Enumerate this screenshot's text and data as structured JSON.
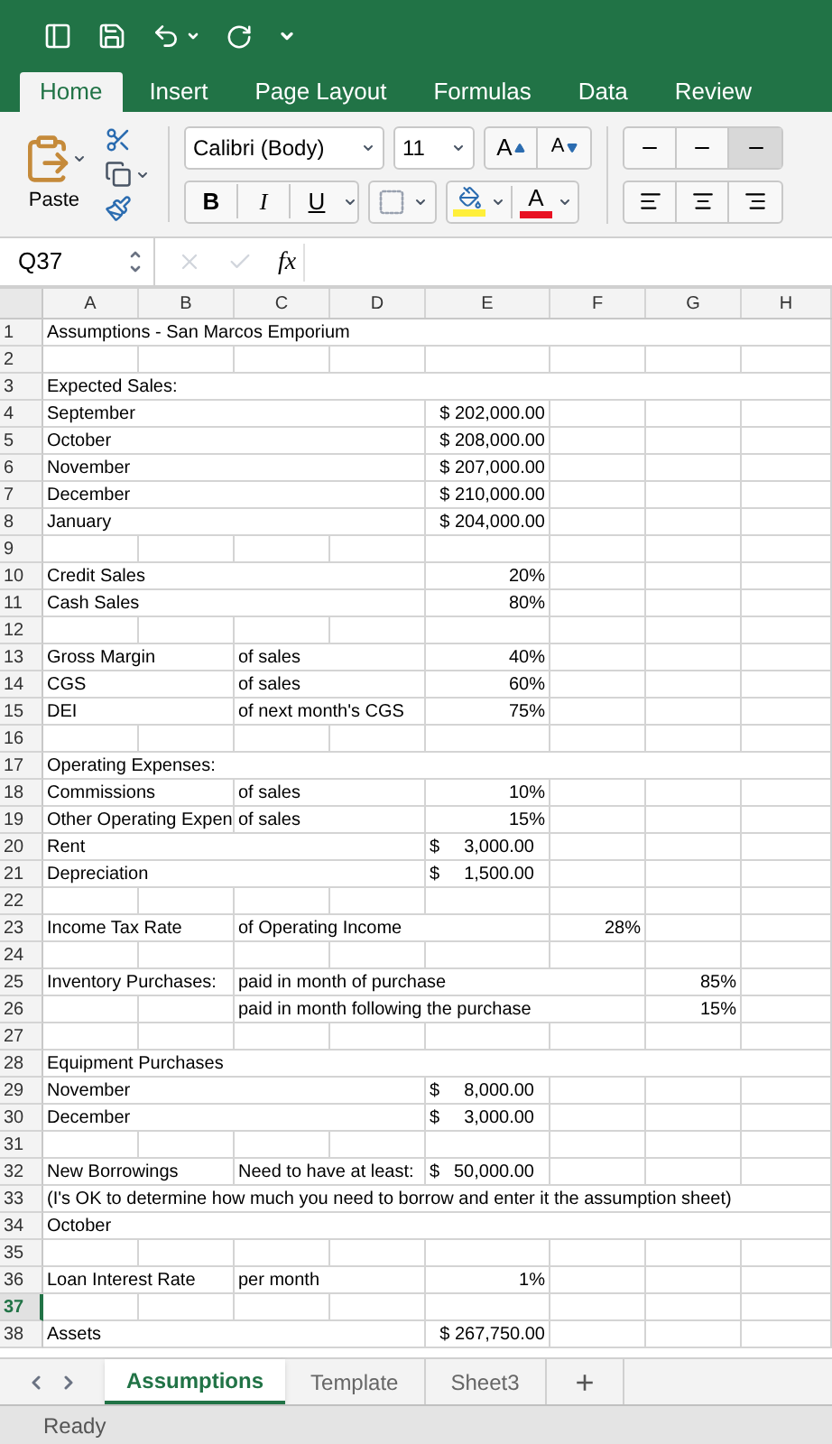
{
  "ribbon_tabs": [
    {
      "label": "Home",
      "selected": true
    },
    {
      "label": "Insert",
      "selected": false
    },
    {
      "label": "Page Layout",
      "selected": false
    },
    {
      "label": "Formulas",
      "selected": false
    },
    {
      "label": "Data",
      "selected": false
    },
    {
      "label": "Review",
      "selected": false
    }
  ],
  "clipboard": {
    "paste_label": "Paste"
  },
  "font": {
    "name": "Calibri (Body)",
    "size": "11",
    "grow": "A",
    "shrink": "A",
    "bold": "B",
    "italic": "I",
    "underline": "U",
    "font_color_letter": "A"
  },
  "formula_bar": {
    "name_box": "Q37",
    "fx": "fx"
  },
  "columns": [
    "A",
    "B",
    "C",
    "D",
    "E",
    "F",
    "G",
    "H"
  ],
  "rows": [
    {
      "num": "1",
      "selected": false,
      "cells": [
        {
          "kind": "text",
          "text": "Assumptions - San Marcos Emporium"
        },
        {
          "kind": "empty"
        },
        {
          "kind": "empty"
        },
        {
          "kind": "empty"
        },
        {
          "kind": "empty"
        },
        {
          "kind": "empty"
        },
        {
          "kind": "empty"
        },
        {
          "kind": "empty"
        }
      ]
    },
    {
      "num": "2",
      "selected": false,
      "cells": [
        {
          "kind": "empty"
        },
        {
          "kind": "empty"
        },
        {
          "kind": "empty"
        },
        {
          "kind": "empty"
        },
        {
          "kind": "empty"
        },
        {
          "kind": "empty"
        },
        {
          "kind": "empty"
        },
        {
          "kind": "empty"
        }
      ]
    },
    {
      "num": "3",
      "selected": false,
      "cells": [
        {
          "kind": "text",
          "text": "Expected Sales:"
        },
        {
          "kind": "empty"
        },
        {
          "kind": "empty"
        },
        {
          "kind": "empty"
        },
        {
          "kind": "empty"
        },
        {
          "kind": "empty"
        },
        {
          "kind": "empty"
        },
        {
          "kind": "empty"
        }
      ]
    },
    {
      "num": "4",
      "selected": false,
      "cells": [
        {
          "kind": "text",
          "text": "September"
        },
        {
          "kind": "empty"
        },
        {
          "kind": "empty"
        },
        {
          "kind": "empty"
        },
        {
          "kind": "number",
          "text": "$ 202,000.00"
        },
        {
          "kind": "empty"
        },
        {
          "kind": "empty"
        },
        {
          "kind": "empty"
        }
      ]
    },
    {
      "num": "5",
      "selected": false,
      "cells": [
        {
          "kind": "text",
          "text": "October"
        },
        {
          "kind": "empty"
        },
        {
          "kind": "empty"
        },
        {
          "kind": "empty"
        },
        {
          "kind": "number",
          "text": "$ 208,000.00"
        },
        {
          "kind": "empty"
        },
        {
          "kind": "empty"
        },
        {
          "kind": "empty"
        }
      ]
    },
    {
      "num": "6",
      "selected": false,
      "cells": [
        {
          "kind": "text",
          "text": "November"
        },
        {
          "kind": "empty"
        },
        {
          "kind": "empty"
        },
        {
          "kind": "empty"
        },
        {
          "kind": "number",
          "text": "$ 207,000.00"
        },
        {
          "kind": "empty"
        },
        {
          "kind": "empty"
        },
        {
          "kind": "empty"
        }
      ]
    },
    {
      "num": "7",
      "selected": false,
      "cells": [
        {
          "kind": "text",
          "text": "December"
        },
        {
          "kind": "empty"
        },
        {
          "kind": "empty"
        },
        {
          "kind": "empty"
        },
        {
          "kind": "number",
          "text": "$ 210,000.00"
        },
        {
          "kind": "empty"
        },
        {
          "kind": "empty"
        },
        {
          "kind": "empty"
        }
      ]
    },
    {
      "num": "8",
      "selected": false,
      "cells": [
        {
          "kind": "text",
          "text": "January"
        },
        {
          "kind": "empty"
        },
        {
          "kind": "empty"
        },
        {
          "kind": "empty"
        },
        {
          "kind": "number",
          "text": "$ 204,000.00"
        },
        {
          "kind": "empty"
        },
        {
          "kind": "empty"
        },
        {
          "kind": "empty"
        }
      ]
    },
    {
      "num": "9",
      "selected": false,
      "cells": [
        {
          "kind": "empty"
        },
        {
          "kind": "empty"
        },
        {
          "kind": "empty"
        },
        {
          "kind": "empty"
        },
        {
          "kind": "empty"
        },
        {
          "kind": "empty"
        },
        {
          "kind": "empty"
        },
        {
          "kind": "empty"
        }
      ]
    },
    {
      "num": "10",
      "selected": false,
      "cells": [
        {
          "kind": "text",
          "text": "Credit Sales"
        },
        {
          "kind": "empty"
        },
        {
          "kind": "empty"
        },
        {
          "kind": "empty"
        },
        {
          "kind": "number",
          "text": "20%"
        },
        {
          "kind": "empty"
        },
        {
          "kind": "empty"
        },
        {
          "kind": "empty"
        }
      ]
    },
    {
      "num": "11",
      "selected": false,
      "cells": [
        {
          "kind": "text",
          "text": "Cash Sales"
        },
        {
          "kind": "empty"
        },
        {
          "kind": "empty"
        },
        {
          "kind": "empty"
        },
        {
          "kind": "number",
          "text": "80%"
        },
        {
          "kind": "empty"
        },
        {
          "kind": "empty"
        },
        {
          "kind": "empty"
        }
      ]
    },
    {
      "num": "12",
      "selected": false,
      "cells": [
        {
          "kind": "empty"
        },
        {
          "kind": "empty"
        },
        {
          "kind": "empty"
        },
        {
          "kind": "empty"
        },
        {
          "kind": "empty"
        },
        {
          "kind": "empty"
        },
        {
          "kind": "empty"
        },
        {
          "kind": "empty"
        }
      ]
    },
    {
      "num": "13",
      "selected": false,
      "cells": [
        {
          "kind": "text",
          "text": "Gross Margin"
        },
        {
          "kind": "empty"
        },
        {
          "kind": "text",
          "text": "of sales"
        },
        {
          "kind": "empty"
        },
        {
          "kind": "number",
          "text": "40%"
        },
        {
          "kind": "empty"
        },
        {
          "kind": "empty"
        },
        {
          "kind": "empty"
        }
      ]
    },
    {
      "num": "14",
      "selected": false,
      "cells": [
        {
          "kind": "text",
          "text": "CGS"
        },
        {
          "kind": "empty"
        },
        {
          "kind": "text",
          "text": "of sales"
        },
        {
          "kind": "empty"
        },
        {
          "kind": "number",
          "text": "60%"
        },
        {
          "kind": "empty"
        },
        {
          "kind": "empty"
        },
        {
          "kind": "empty"
        }
      ]
    },
    {
      "num": "15",
      "selected": false,
      "cells": [
        {
          "kind": "text",
          "text": "DEI"
        },
        {
          "kind": "empty"
        },
        {
          "kind": "text",
          "text": "of next month's CGS"
        },
        {
          "kind": "empty"
        },
        {
          "kind": "number",
          "text": "75%"
        },
        {
          "kind": "empty"
        },
        {
          "kind": "empty"
        },
        {
          "kind": "empty"
        }
      ]
    },
    {
      "num": "16",
      "selected": false,
      "cells": [
        {
          "kind": "empty"
        },
        {
          "kind": "empty"
        },
        {
          "kind": "empty"
        },
        {
          "kind": "empty"
        },
        {
          "kind": "empty"
        },
        {
          "kind": "empty"
        },
        {
          "kind": "empty"
        },
        {
          "kind": "empty"
        }
      ]
    },
    {
      "num": "17",
      "selected": false,
      "cells": [
        {
          "kind": "text",
          "text": "Operating Expenses:"
        },
        {
          "kind": "empty"
        },
        {
          "kind": "empty"
        },
        {
          "kind": "empty"
        },
        {
          "kind": "empty"
        },
        {
          "kind": "empty"
        },
        {
          "kind": "empty"
        },
        {
          "kind": "empty"
        }
      ]
    },
    {
      "num": "18",
      "selected": false,
      "cells": [
        {
          "kind": "text",
          "text": "Commissions"
        },
        {
          "kind": "empty"
        },
        {
          "kind": "text",
          "text": "of sales"
        },
        {
          "kind": "empty"
        },
        {
          "kind": "number",
          "text": "10%"
        },
        {
          "kind": "empty"
        },
        {
          "kind": "empty"
        },
        {
          "kind": "empty"
        }
      ]
    },
    {
      "num": "19",
      "selected": false,
      "cells": [
        {
          "kind": "text",
          "text": "Other Operating Expen"
        },
        {
          "kind": "empty"
        },
        {
          "kind": "text",
          "text": "of sales"
        },
        {
          "kind": "empty"
        },
        {
          "kind": "number",
          "text": "15%"
        },
        {
          "kind": "empty"
        },
        {
          "kind": "empty"
        },
        {
          "kind": "empty"
        }
      ]
    },
    {
      "num": "20",
      "selected": false,
      "cells": [
        {
          "kind": "text",
          "text": "Rent"
        },
        {
          "kind": "empty"
        },
        {
          "kind": "empty"
        },
        {
          "kind": "empty"
        },
        {
          "kind": "currency",
          "symbol": "$",
          "amount": "3,000.00"
        },
        {
          "kind": "empty"
        },
        {
          "kind": "empty"
        },
        {
          "kind": "empty"
        }
      ]
    },
    {
      "num": "21",
      "selected": false,
      "cells": [
        {
          "kind": "text",
          "text": "Depreciation"
        },
        {
          "kind": "empty"
        },
        {
          "kind": "empty"
        },
        {
          "kind": "empty"
        },
        {
          "kind": "currency",
          "symbol": "$",
          "amount": "1,500.00"
        },
        {
          "kind": "empty"
        },
        {
          "kind": "empty"
        },
        {
          "kind": "empty"
        }
      ]
    },
    {
      "num": "22",
      "selected": false,
      "cells": [
        {
          "kind": "empty"
        },
        {
          "kind": "empty"
        },
        {
          "kind": "empty"
        },
        {
          "kind": "empty"
        },
        {
          "kind": "empty"
        },
        {
          "kind": "empty"
        },
        {
          "kind": "empty"
        },
        {
          "kind": "empty"
        }
      ]
    },
    {
      "num": "23",
      "selected": false,
      "cells": [
        {
          "kind": "text",
          "text": "Income Tax Rate"
        },
        {
          "kind": "empty"
        },
        {
          "kind": "text",
          "text": "of Operating Income"
        },
        {
          "kind": "empty"
        },
        {
          "kind": "empty"
        },
        {
          "kind": "number",
          "text": "28%"
        },
        {
          "kind": "empty"
        },
        {
          "kind": "empty"
        }
      ]
    },
    {
      "num": "24",
      "selected": false,
      "cells": [
        {
          "kind": "empty"
        },
        {
          "kind": "empty"
        },
        {
          "kind": "empty"
        },
        {
          "kind": "empty"
        },
        {
          "kind": "empty"
        },
        {
          "kind": "empty"
        },
        {
          "kind": "empty"
        },
        {
          "kind": "empty"
        }
      ]
    },
    {
      "num": "25",
      "selected": false,
      "cells": [
        {
          "kind": "text",
          "text": "Inventory Purchases:"
        },
        {
          "kind": "empty"
        },
        {
          "kind": "text",
          "text": "paid in month of purchase"
        },
        {
          "kind": "empty"
        },
        {
          "kind": "empty"
        },
        {
          "kind": "empty"
        },
        {
          "kind": "number",
          "text": "85%"
        },
        {
          "kind": "empty"
        }
      ]
    },
    {
      "num": "26",
      "selected": false,
      "cells": [
        {
          "kind": "empty"
        },
        {
          "kind": "empty"
        },
        {
          "kind": "text",
          "text": "paid in month following the purchase"
        },
        {
          "kind": "empty"
        },
        {
          "kind": "empty"
        },
        {
          "kind": "empty"
        },
        {
          "kind": "number",
          "text": "15%"
        },
        {
          "kind": "empty"
        }
      ]
    },
    {
      "num": "27",
      "selected": false,
      "cells": [
        {
          "kind": "empty"
        },
        {
          "kind": "empty"
        },
        {
          "kind": "empty"
        },
        {
          "kind": "empty"
        },
        {
          "kind": "empty"
        },
        {
          "kind": "empty"
        },
        {
          "kind": "empty"
        },
        {
          "kind": "empty"
        }
      ]
    },
    {
      "num": "28",
      "selected": false,
      "cells": [
        {
          "kind": "text",
          "text": "Equipment Purchases"
        },
        {
          "kind": "empty"
        },
        {
          "kind": "empty"
        },
        {
          "kind": "empty"
        },
        {
          "kind": "empty"
        },
        {
          "kind": "empty"
        },
        {
          "kind": "empty"
        },
        {
          "kind": "empty"
        }
      ]
    },
    {
      "num": "29",
      "selected": false,
      "cells": [
        {
          "kind": "text",
          "text": "November"
        },
        {
          "kind": "empty"
        },
        {
          "kind": "empty"
        },
        {
          "kind": "empty"
        },
        {
          "kind": "currency",
          "symbol": "$",
          "amount": "8,000.00"
        },
        {
          "kind": "empty"
        },
        {
          "kind": "empty"
        },
        {
          "kind": "empty"
        }
      ]
    },
    {
      "num": "30",
      "selected": false,
      "cells": [
        {
          "kind": "text",
          "text": "December"
        },
        {
          "kind": "empty"
        },
        {
          "kind": "empty"
        },
        {
          "kind": "empty"
        },
        {
          "kind": "currency",
          "symbol": "$",
          "amount": "3,000.00"
        },
        {
          "kind": "empty"
        },
        {
          "kind": "empty"
        },
        {
          "kind": "empty"
        }
      ]
    },
    {
      "num": "31",
      "selected": false,
      "cells": [
        {
          "kind": "empty"
        },
        {
          "kind": "empty"
        },
        {
          "kind": "empty"
        },
        {
          "kind": "empty"
        },
        {
          "kind": "empty"
        },
        {
          "kind": "empty"
        },
        {
          "kind": "empty"
        },
        {
          "kind": "empty"
        }
      ]
    },
    {
      "num": "32",
      "selected": false,
      "cells": [
        {
          "kind": "text",
          "text": "New Borrowings"
        },
        {
          "kind": "empty"
        },
        {
          "kind": "text",
          "text": "Need to have at least:"
        },
        {
          "kind": "empty"
        },
        {
          "kind": "currency",
          "symbol": "$",
          "amount": "50,000.00"
        },
        {
          "kind": "empty"
        },
        {
          "kind": "empty"
        },
        {
          "kind": "empty"
        }
      ]
    },
    {
      "num": "33",
      "selected": false,
      "cells": [
        {
          "kind": "text",
          "text": "(I's OK to determine how much you need to borrow and enter it the assumption sheet)"
        },
        {
          "kind": "empty"
        },
        {
          "kind": "empty"
        },
        {
          "kind": "empty"
        },
        {
          "kind": "empty"
        },
        {
          "kind": "empty"
        },
        {
          "kind": "empty"
        },
        {
          "kind": "empty"
        }
      ]
    },
    {
      "num": "34",
      "selected": false,
      "cells": [
        {
          "kind": "text",
          "text": "October"
        },
        {
          "kind": "empty"
        },
        {
          "kind": "empty"
        },
        {
          "kind": "empty"
        },
        {
          "kind": "empty"
        },
        {
          "kind": "empty"
        },
        {
          "kind": "empty"
        },
        {
          "kind": "empty"
        }
      ]
    },
    {
      "num": "35",
      "selected": false,
      "cells": [
        {
          "kind": "empty"
        },
        {
          "kind": "empty"
        },
        {
          "kind": "empty"
        },
        {
          "kind": "empty"
        },
        {
          "kind": "empty"
        },
        {
          "kind": "empty"
        },
        {
          "kind": "empty"
        },
        {
          "kind": "empty"
        }
      ]
    },
    {
      "num": "36",
      "selected": false,
      "cells": [
        {
          "kind": "text",
          "text": "Loan Interest Rate"
        },
        {
          "kind": "empty"
        },
        {
          "kind": "text",
          "text": "per month"
        },
        {
          "kind": "empty"
        },
        {
          "kind": "number",
          "text": "1%"
        },
        {
          "kind": "empty"
        },
        {
          "kind": "empty"
        },
        {
          "kind": "empty"
        }
      ]
    },
    {
      "num": "37",
      "selected": true,
      "cells": [
        {
          "kind": "empty"
        },
        {
          "kind": "empty"
        },
        {
          "kind": "empty"
        },
        {
          "kind": "empty"
        },
        {
          "kind": "empty"
        },
        {
          "kind": "empty"
        },
        {
          "kind": "empty"
        },
        {
          "kind": "empty"
        }
      ]
    },
    {
      "num": "38",
      "selected": false,
      "cells": [
        {
          "kind": "text",
          "text": "Assets"
        },
        {
          "kind": "empty"
        },
        {
          "kind": "empty"
        },
        {
          "kind": "empty"
        },
        {
          "kind": "number",
          "text": "$ 267,750.00"
        },
        {
          "kind": "empty"
        },
        {
          "kind": "empty"
        },
        {
          "kind": "empty"
        }
      ]
    }
  ],
  "sheet_tabs": [
    {
      "label": "Assumptions",
      "selected": true
    },
    {
      "label": "Template",
      "selected": false
    },
    {
      "label": "Sheet3",
      "selected": false
    }
  ],
  "add_sheet": "+",
  "status": "Ready"
}
